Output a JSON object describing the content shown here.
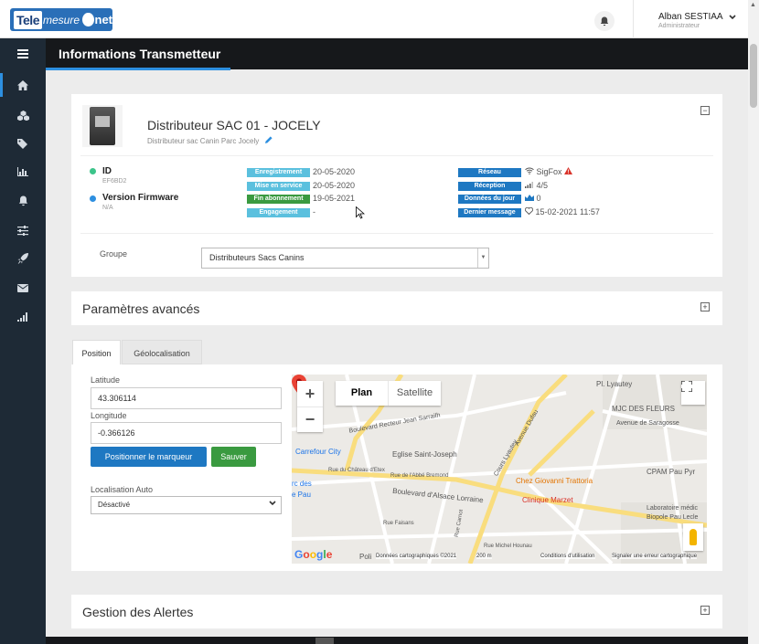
{
  "topbar": {
    "logo": {
      "part1": "Tele",
      "part2": "mesure",
      "part3": "net"
    },
    "bell_icon": "bell-icon",
    "user_name": "Alban SESTIAA",
    "user_role": "Administrateur"
  },
  "sidebar": {
    "items": [
      "home-icon",
      "cubes-icon",
      "tags-icon",
      "bar-chart-icon",
      "bell-icon",
      "sliders-icon",
      "rocket-icon",
      "envelope-icon",
      "signal-icon"
    ]
  },
  "header": {
    "title": "Informations Transmetteur"
  },
  "device": {
    "title": "Distributeur SAC 01 - JOCELY",
    "subtitle": "Distributeur sac Canin Parc Jocely",
    "id_label": "ID",
    "id_value": "EF6BD2",
    "firmware_label": "Version Firmware",
    "firmware_value": "N/A",
    "dates": [
      {
        "label": "Enregistrement",
        "value": "20-05-2020",
        "color": "#5bc0de"
      },
      {
        "label": "Mise en service",
        "value": "20-05-2020",
        "color": "#5bc0de"
      },
      {
        "label": "Fin abonnement",
        "value": "19-05-2021",
        "color": "#3a9a40"
      },
      {
        "label": "Engagement",
        "value": "-",
        "color": "#5bc0de"
      }
    ],
    "network": [
      {
        "label": "Réseau",
        "value": "SigFox",
        "icon": "wifi-icon",
        "extra_icon": "warning-icon"
      },
      {
        "label": "Réception",
        "value": "4/5",
        "icon": "signal-bars-icon"
      },
      {
        "label": "Données du jour",
        "value": "0",
        "icon": "area-chart-icon"
      },
      {
        "label": "Dernier message",
        "value": "15-02-2021 11:57",
        "icon": "heart-icon"
      }
    ],
    "groupe_label": "Groupe",
    "groupe_value": "Distributeurs Sacs Canins"
  },
  "advanced": {
    "title": "Paramètres avancés",
    "tabs": [
      "Position",
      "Géolocalisation"
    ],
    "latitude_label": "Latitude",
    "latitude_value": "43.306114",
    "longitude_label": "Longitude",
    "longitude_value": "-0.366126",
    "position_button": "Positionner le marqueur",
    "save_button": "Sauver",
    "auto_label": "Localisation Auto",
    "auto_value": "Désactivé"
  },
  "map": {
    "type_plan": "Plan",
    "type_satellite": "Satellite",
    "labels": [
      {
        "text": "Pl. Lyautey",
        "cls": ""
      },
      {
        "text": "MJC DES FLEURS",
        "cls": ""
      },
      {
        "text": "Avenue de Saragosse",
        "cls": ""
      },
      {
        "text": "Boulevard Recteur Jean Sarrailh",
        "cls": ""
      },
      {
        "text": "Carrefour City",
        "cls": "poi-blue"
      },
      {
        "text": "Eglise Saint-Joseph",
        "cls": ""
      },
      {
        "text": "CPAM Pau Pyr",
        "cls": ""
      },
      {
        "text": "Chez Giovanni Trattoria",
        "cls": "poi-orange"
      },
      {
        "text": "Clinique Marzet",
        "cls": "poi-red"
      },
      {
        "text": "Boulevard d'Alsace Lorraine",
        "cls": ""
      },
      {
        "text": "Laboratoire médic",
        "cls": ""
      },
      {
        "text": "Biopole Pau Lecle",
        "cls": ""
      },
      {
        "text": "Cours Lyautey",
        "cls": ""
      },
      {
        "text": "Avenue Dufau",
        "cls": ""
      },
      {
        "text": "Rue de l'Abbé Bremond",
        "cls": ""
      },
      {
        "text": "Rue du Château d'Etex",
        "cls": ""
      },
      {
        "text": "Rue Carnot",
        "cls": ""
      },
      {
        "text": "Rue Michel Hounau",
        "cls": ""
      },
      {
        "text": "Rue Faisans",
        "cls": ""
      },
      {
        "text": "rc des",
        "cls": "poi-blue"
      },
      {
        "text": "e Pau",
        "cls": "poi-blue"
      },
      {
        "text": "Poli",
        "cls": ""
      }
    ],
    "google": "Google",
    "footer": [
      "Données cartographiques ©2021",
      "200 m",
      "Conditions d'utilisation",
      "Signaler une erreur cartographique"
    ]
  },
  "alerts": {
    "title": "Gestion des Alertes"
  }
}
